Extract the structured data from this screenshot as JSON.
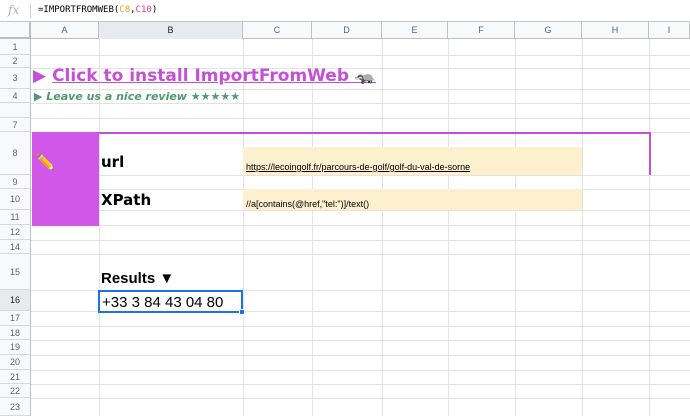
{
  "formula_bar": {
    "icon": "fx",
    "prefix": "=IMPORTFROMWEB(",
    "ref1": "C8",
    "comma": ",",
    "ref2": "C10",
    "suffix": ")"
  },
  "columns": [
    "A",
    "B",
    "C",
    "D",
    "E",
    "F",
    "G",
    "H",
    "I"
  ],
  "rows": [
    "1",
    "2",
    "3",
    "4",
    "7",
    "8",
    "9",
    "10",
    "11",
    "12",
    "14",
    "15",
    "16",
    "17",
    "18",
    "19",
    "20",
    "21",
    "22",
    "23"
  ],
  "content": {
    "install_arrow": "▶",
    "install_link": "Click to install ImportFromWeb 🦡",
    "review": "▶ Leave us a nice review ★★★★★",
    "pencil": "✏️",
    "url_label": "url",
    "url_value": "https://lecoingolf.fr/parcours-de-golf/golf-du-val-de-sorne",
    "xpath_label": "XPath",
    "xpath_value": "//a[contains(@href,\"tel:\")]/text()",
    "results_label": "Results ▼",
    "result_value": "+33 3 84 43 04 80"
  },
  "colors": {
    "accent_purple": "#d157e8",
    "link_purple": "#c54fd6",
    "review_green": "#4e9a6e",
    "input_yellow": "#fdf0cf",
    "selection_blue": "#1a73e8"
  }
}
